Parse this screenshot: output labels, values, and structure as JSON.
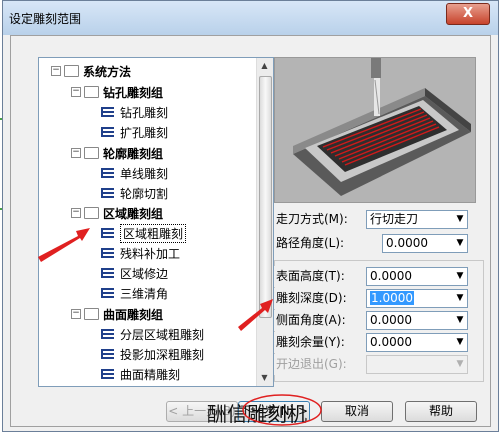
{
  "window": {
    "title": "设定雕刻范围",
    "close_label": "X"
  },
  "tree": {
    "nodes": [
      {
        "label": "系统方法",
        "level": 0,
        "kind": "folder",
        "bold": true
      },
      {
        "label": "钻孔雕刻组",
        "level": 1,
        "kind": "folder",
        "bold": true
      },
      {
        "label": "钻孔雕刻",
        "level": 2,
        "kind": "leaf"
      },
      {
        "label": "扩孔雕刻",
        "level": 2,
        "kind": "leaf"
      },
      {
        "label": "轮廓雕刻组",
        "level": 1,
        "kind": "folder",
        "bold": true
      },
      {
        "label": "单线雕刻",
        "level": 2,
        "kind": "leaf"
      },
      {
        "label": "轮廓切割",
        "level": 2,
        "kind": "leaf"
      },
      {
        "label": "区域雕刻组",
        "level": 1,
        "kind": "folder",
        "bold": true
      },
      {
        "label": "区域粗雕刻",
        "level": 2,
        "kind": "leaf",
        "selected": true
      },
      {
        "label": "残料补加工",
        "level": 2,
        "kind": "leaf"
      },
      {
        "label": "区域修边",
        "level": 2,
        "kind": "leaf"
      },
      {
        "label": "三维清角",
        "level": 2,
        "kind": "leaf"
      },
      {
        "label": "曲面雕刻组",
        "level": 1,
        "kind": "folder",
        "bold": true
      },
      {
        "label": "分层区域粗雕刻",
        "level": 2,
        "kind": "leaf"
      },
      {
        "label": "投影加深粗雕刻",
        "level": 2,
        "kind": "leaf"
      },
      {
        "label": "曲面精雕刻",
        "level": 2,
        "kind": "leaf"
      }
    ]
  },
  "params": {
    "tool_path": {
      "label": "走刀方式(M):",
      "value": "行切走刀"
    },
    "path_angle": {
      "label": "路径角度(L):",
      "value": "0.0000"
    },
    "surface_height": {
      "label": "表面高度(T):",
      "value": "0.0000"
    },
    "depth": {
      "label": "雕刻深度(D):",
      "value": "1.0000"
    },
    "side_angle": {
      "label": "侧面角度(A):",
      "value": "0.0000"
    },
    "allowance": {
      "label": "雕刻余量(Y):",
      "value": "0.0000"
    },
    "hidden_row": {
      "label": "开边退出(G):",
      "value": ""
    }
  },
  "buttons": {
    "prev": "< 上一步(B)",
    "next": "下一步(N) >",
    "cancel": "取消",
    "help": "帮助"
  },
  "watermark": "酬信雕刻机",
  "colors": {
    "arrow": "#e02020",
    "selection": "#3399ff",
    "title_bg": "#c9dcf1"
  }
}
